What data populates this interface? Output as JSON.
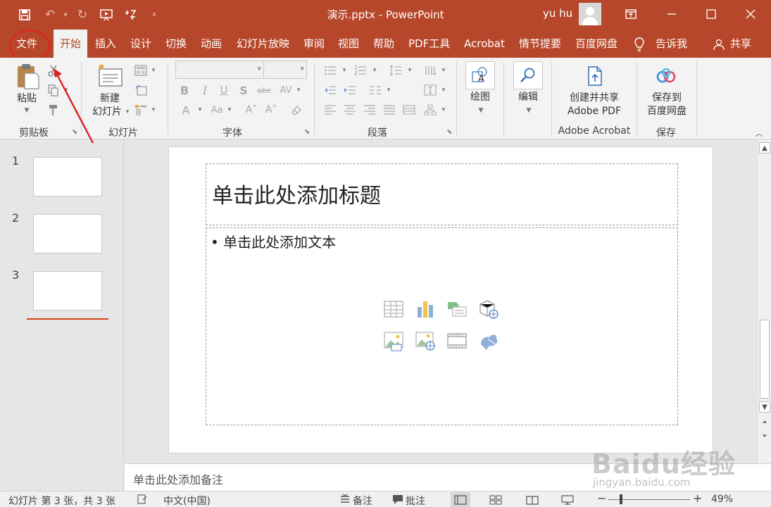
{
  "titlebar": {
    "document_title": "演示.pptx - PowerPoint",
    "user_name": "yu hu"
  },
  "tabs": [
    {
      "label": "文件"
    },
    {
      "label": "开始"
    },
    {
      "label": "插入"
    },
    {
      "label": "设计"
    },
    {
      "label": "切换"
    },
    {
      "label": "动画"
    },
    {
      "label": "幻灯片放映"
    },
    {
      "label": "审阅"
    },
    {
      "label": "视图"
    },
    {
      "label": "帮助"
    },
    {
      "label": "PDF工具"
    },
    {
      "label": "Acrobat"
    },
    {
      "label": "情节提要"
    },
    {
      "label": "百度网盘"
    },
    {
      "label": "告诉我"
    },
    {
      "label": "共享"
    }
  ],
  "ribbon": {
    "clipboard": {
      "paste_label": "粘贴",
      "group_label": "剪贴板"
    },
    "slides": {
      "new_slide_line1": "新建",
      "new_slide_line2": "幻灯片",
      "group_label": "幻灯片"
    },
    "font": {
      "group_label": "字体"
    },
    "paragraph": {
      "group_label": "段落"
    },
    "drawing": {
      "label": "绘图"
    },
    "editing": {
      "label": "编辑"
    },
    "adobe": {
      "line1": "创建并共享",
      "line2": "Adobe PDF",
      "group_label": "Adobe Acrobat"
    },
    "baidu": {
      "line1": "保存到",
      "line2": "百度网盘",
      "group_label": "保存"
    }
  },
  "thumbnails": [
    {
      "number": "1"
    },
    {
      "number": "2"
    },
    {
      "number": "3"
    }
  ],
  "slide": {
    "title_placeholder": "单击此处添加标题",
    "body_placeholder": "• 单击此处添加文本"
  },
  "notes": {
    "placeholder": "单击此处添加备注"
  },
  "status": {
    "slide_info": "幻灯片 第 3 张，共 3 张",
    "language": "中文(中国)",
    "notes_label": "备注",
    "comments_label": "批注",
    "zoom": "49%"
  },
  "watermark": {
    "main": "Baidu经验",
    "sub": "jingyan.baidu.com"
  },
  "colors": {
    "accent": "#b7472a",
    "annotation": "#e02020"
  }
}
